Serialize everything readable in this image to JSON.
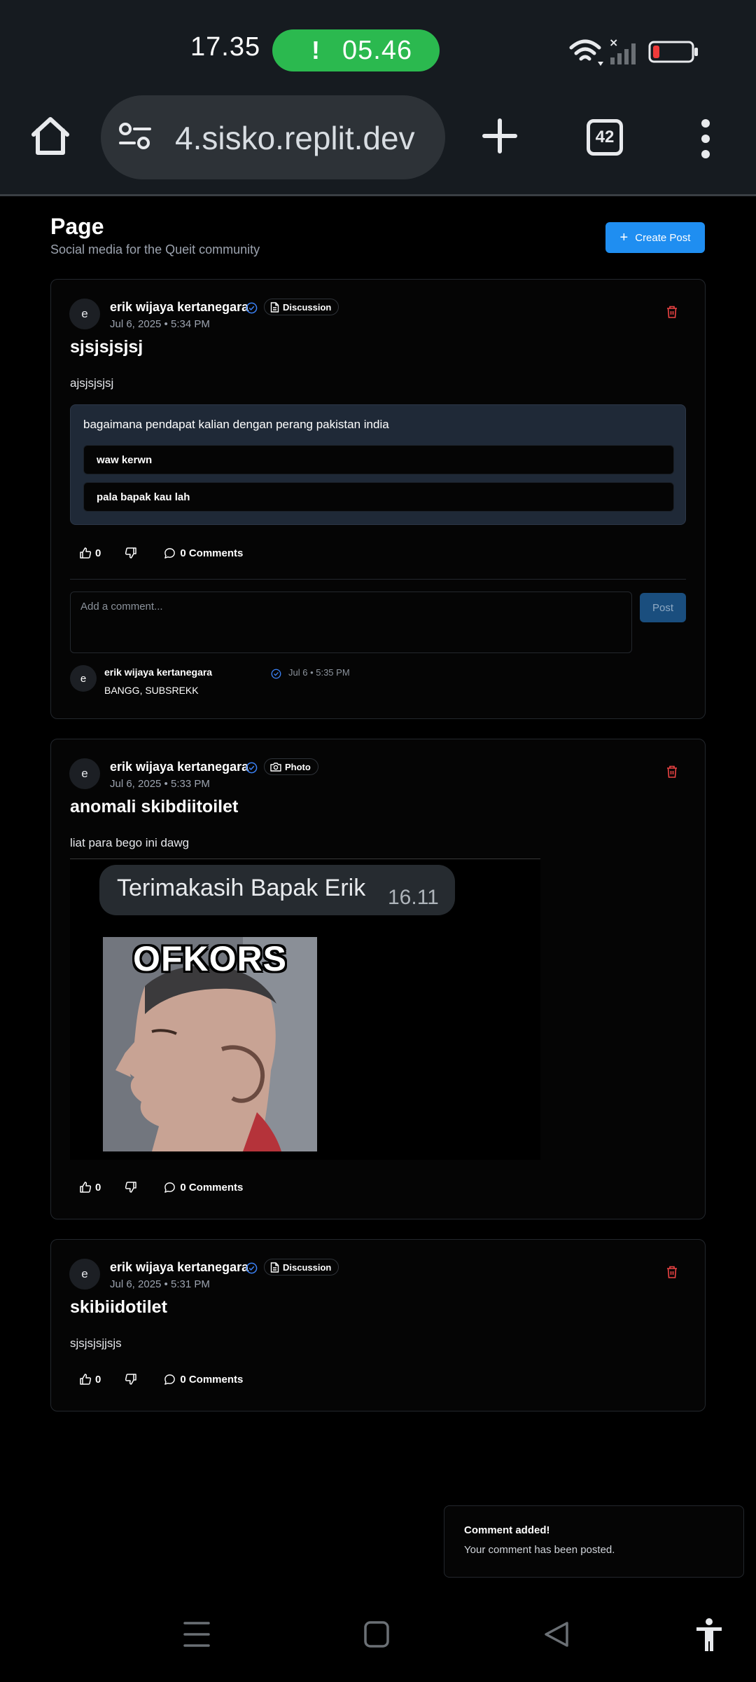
{
  "status_bar": {
    "time": "17.35",
    "call_timer": "05.46",
    "call_alert": "!"
  },
  "browser": {
    "url": "4.sisko.replit.dev",
    "tab_count": "42"
  },
  "header": {
    "title": "Page",
    "subtitle": "Social media for the Queit community",
    "create_label": "Create Post"
  },
  "posts": [
    {
      "avatar": "e",
      "author": "erik wijaya kertanegara",
      "tag": "Discussion",
      "date": "Jul 6, 2025 • 5:34 PM",
      "title": "sjsjsjsjsj",
      "body": "ajsjsjsjsj",
      "poll": {
        "question": "bagaimana pendapat kalian dengan perang pakistan india",
        "options": [
          "waw kerwn",
          "pala bapak kau lah"
        ]
      },
      "likes": "0",
      "comments_label": "0 Comments",
      "comment_placeholder": "Add a comment...",
      "post_label": "Post",
      "comment": {
        "avatar": "e",
        "author": "erik wijaya kertanegara",
        "meta": "Jul 6 • 5:35 PM",
        "text": "BANGG, SUBSREKK"
      }
    },
    {
      "avatar": "e",
      "author": "erik wijaya kertanegara",
      "tag": "Photo",
      "date": "Jul 6, 2025 • 5:33 PM",
      "title": "anomali skibdiitoilet",
      "body": "liat para bego ini dawg",
      "photo": {
        "bubble_text": "Terimakasih Bapak Erik",
        "bubble_time": "16.11",
        "meme_caption": "OFKORS"
      },
      "likes": "0",
      "comments_label": "0 Comments"
    },
    {
      "avatar": "e",
      "author": "erik wijaya kertanegara",
      "tag": "Discussion",
      "date": "Jul 6, 2025 • 5:31 PM",
      "title": "skibiidotilet",
      "body": "sjsjsjsjjsjs",
      "likes": "0",
      "comments_label": "0 Comments"
    }
  ],
  "toast": {
    "title": "Comment added!",
    "message": "Your comment has been posted."
  },
  "colors": {
    "accent": "#1f8ef1",
    "danger": "#ef4444",
    "verified": "#3b82f6",
    "call_green": "#2bb94f",
    "poll_bg": "#1f2937"
  }
}
